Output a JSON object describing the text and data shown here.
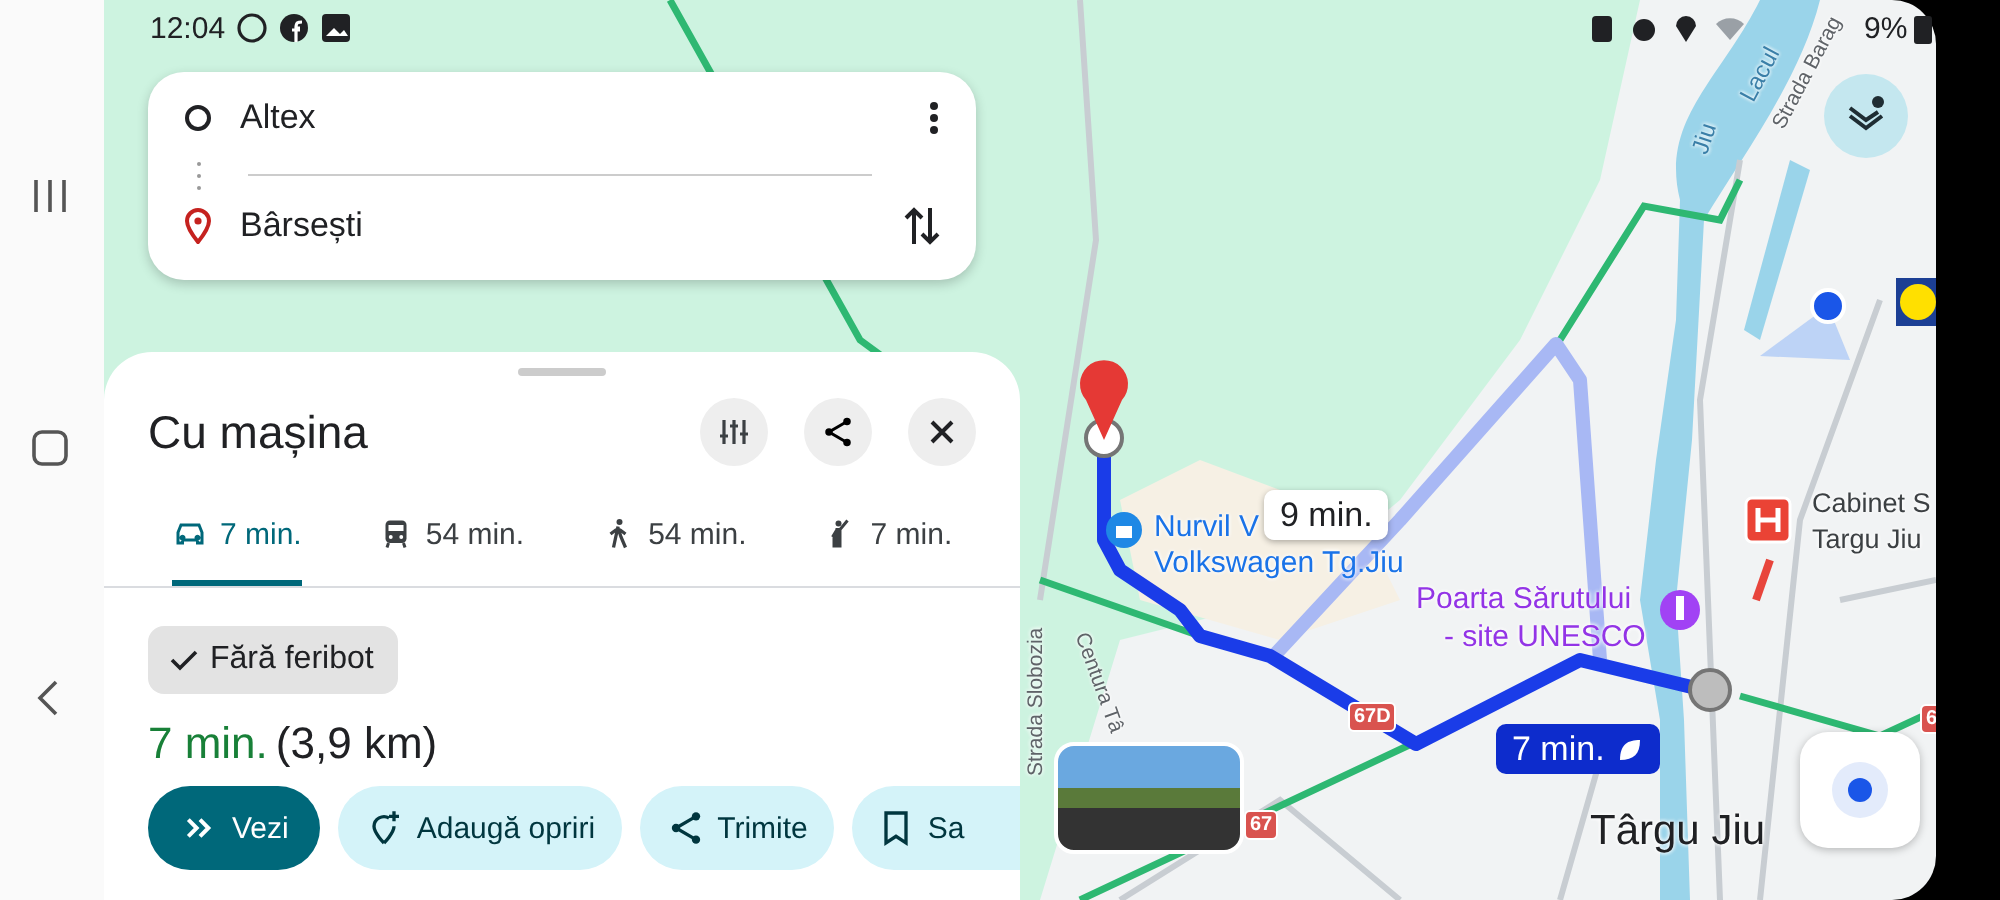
{
  "status_bar": {
    "time": "12:04",
    "battery": "9%"
  },
  "directions": {
    "origin": "Altex",
    "destination": "Bârsești"
  },
  "sheet": {
    "title": "Cu mașina",
    "modes": [
      {
        "kind": "car",
        "label": "7 min.",
        "selected": true
      },
      {
        "kind": "transit",
        "label": "54 min.",
        "selected": false
      },
      {
        "kind": "walk",
        "label": "54 min.",
        "selected": false
      },
      {
        "kind": "ride",
        "label": "7 min.",
        "selected": false
      }
    ],
    "filter": {
      "label": "Fără feribot",
      "checked": true
    },
    "duration": "7 min.",
    "distance": "(3,9 km)",
    "actions": [
      {
        "kind": "start",
        "label": "Vezi"
      },
      {
        "kind": "add-stop",
        "label": "Adaugă opriri"
      },
      {
        "kind": "share",
        "label": "Trimite"
      },
      {
        "kind": "save",
        "label": "Sa"
      }
    ]
  },
  "map": {
    "labels": [
      {
        "kind": "water",
        "text": "Lacul"
      },
      {
        "kind": "street",
        "text": "Strada Barag"
      },
      {
        "kind": "water",
        "text": "Jiu"
      },
      {
        "kind": "street",
        "text": "Strada Slobozia"
      },
      {
        "kind": "street",
        "text": "Centura Tâ"
      },
      {
        "kind": "business",
        "text": "Nurvil V"
      },
      {
        "kind": "business",
        "text": "Volkswagen Tg.Jiu"
      },
      {
        "kind": "landmark",
        "text": "Poarta Sărutului"
      },
      {
        "kind": "landmark",
        "text": "- site UNESCO"
      },
      {
        "kind": "medical",
        "text": "Cabinet S"
      },
      {
        "kind": "medical",
        "text": "Targu Jiu"
      },
      {
        "kind": "city",
        "text": "Târgu Jiu"
      }
    ],
    "route_times": [
      {
        "text": "9 min.",
        "selected": false
      },
      {
        "text": "7 min.",
        "selected": true
      }
    ],
    "road_shields": [
      "67D",
      "67",
      "6"
    ]
  }
}
